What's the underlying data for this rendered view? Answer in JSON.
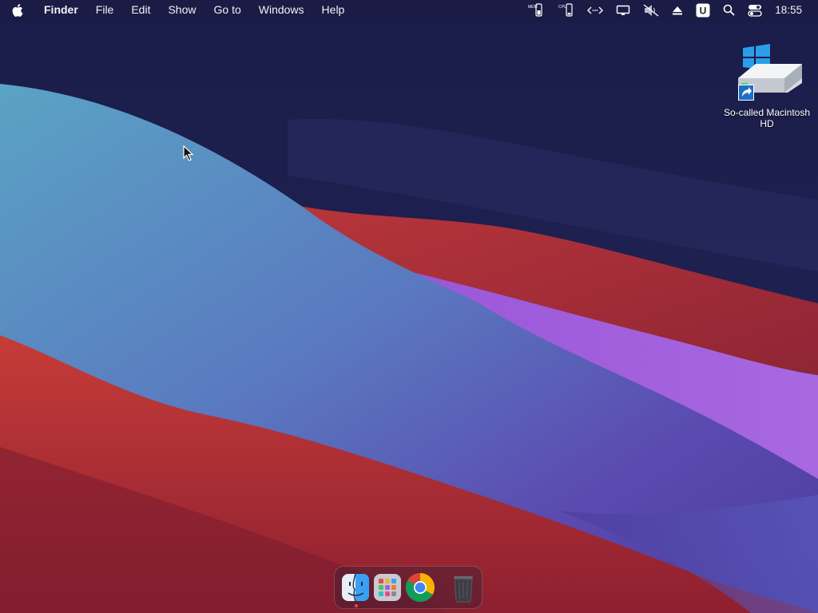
{
  "menubar": {
    "app_name": "Finder",
    "menus": [
      "File",
      "Edit",
      "Show",
      "Go to",
      "Windows",
      "Help"
    ],
    "status_icons": [
      "memory-monitor-icon",
      "cpu-monitor-icon",
      "network-arrows-icon",
      "display-icon",
      "mute-icon",
      "eject-icon",
      "u-app-icon",
      "search-icon",
      "control-center-icon"
    ],
    "mem_label": "MEM",
    "cpu_label": "CPU",
    "u_label": "U",
    "clock": "18:55"
  },
  "desktop": {
    "drive_label": "So-called Macintosh HD"
  },
  "dock": {
    "items": [
      "finder",
      "launchpad",
      "chrome",
      "trash"
    ],
    "running": [
      "finder"
    ]
  },
  "colors": {
    "accent_blue": "#2a9ee8",
    "wallpaper_dark": "#1c1d4a",
    "wallpaper_red": "#c23a36",
    "wallpaper_teal": "#5aa3c4",
    "wallpaper_purple": "#a65fd9"
  }
}
